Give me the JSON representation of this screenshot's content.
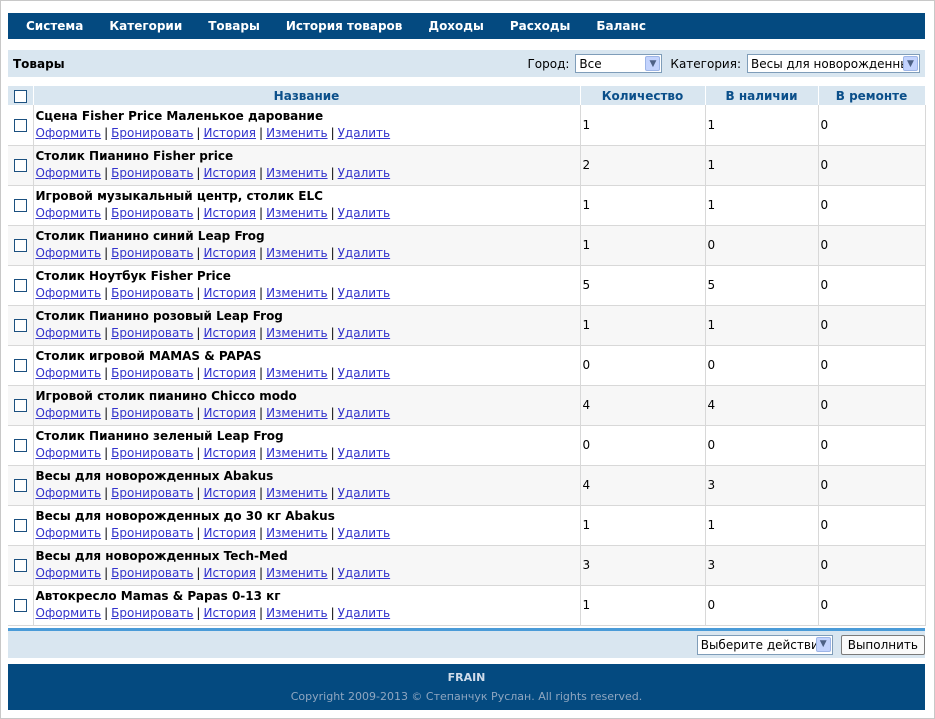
{
  "nav": [
    "Система",
    "Категории",
    "Товары",
    "История товаров",
    "Доходы",
    "Расходы",
    "Баланс"
  ],
  "toolbar": {
    "title": "Товары",
    "city_label": "Город:",
    "city_value": "Все",
    "category_label": "Категория:",
    "category_value": "Весы для новорожденных"
  },
  "table": {
    "headers": [
      "Название",
      "Количество",
      "В наличии",
      "В ремонте"
    ],
    "action_labels": [
      "Оформить",
      "Бронировать",
      "История",
      "Изменить",
      "Удалить"
    ],
    "rows": [
      {
        "name": "Сцена Fisher Price Маленькое дарование",
        "qty": "1",
        "stock": "1",
        "repair": "0"
      },
      {
        "name": "Столик Пианино Fisher price",
        "qty": "2",
        "stock": "1",
        "repair": "0"
      },
      {
        "name": "Игровой музыкальный центр, столик ELC",
        "qty": "1",
        "stock": "1",
        "repair": "0"
      },
      {
        "name": "Столик Пианино синий Leap Frog",
        "qty": "1",
        "stock": "0",
        "repair": "0"
      },
      {
        "name": "Столик Ноутбук Fisher Price",
        "qty": "5",
        "stock": "5",
        "repair": "0"
      },
      {
        "name": "Столик Пианино розовый Leap Frog",
        "qty": "1",
        "stock": "1",
        "repair": "0"
      },
      {
        "name": "Столик игровой MAMAS & PAPAS",
        "qty": "0",
        "stock": "0",
        "repair": "0"
      },
      {
        "name": "Игровой столик пианино Chicco modo",
        "qty": "4",
        "stock": "4",
        "repair": "0"
      },
      {
        "name": "Столик Пианино зеленый Leap Frog",
        "qty": "0",
        "stock": "0",
        "repair": "0"
      },
      {
        "name": "Весы для новорожденных Abakus",
        "qty": "4",
        "stock": "3",
        "repair": "0"
      },
      {
        "name": "Весы для новорожденных до 30 кг Abakus",
        "qty": "1",
        "stock": "1",
        "repair": "0"
      },
      {
        "name": "Весы для новорожденных Tech-Med",
        "qty": "3",
        "stock": "3",
        "repair": "0"
      },
      {
        "name": "Автокресло Mamas & Papas 0-13 кг",
        "qty": "1",
        "stock": "0",
        "repair": "0"
      }
    ]
  },
  "bottom": {
    "action_select": "Выберите действие",
    "execute_label": "Выполнить"
  },
  "footer": {
    "brand": "FRAIN",
    "copyright": "Copyright 2009-2013 © Степанчук Руслан. All rights reserved."
  },
  "colors": {
    "nav_bg": "#044a80",
    "toolbar_bg": "#d9e6f0",
    "header_text": "#0b4f8a",
    "link": "#3333cc",
    "accent_line": "#4a9bd8"
  }
}
